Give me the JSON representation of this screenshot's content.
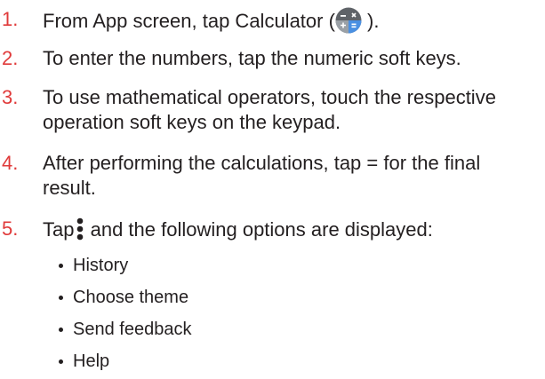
{
  "steps": [
    {
      "number": "1.",
      "before": "From App screen, tap Calculator (",
      "after": " )."
    },
    {
      "number": "2.",
      "text": "To enter the numbers, tap the numeric soft keys."
    },
    {
      "number": "3.",
      "line1": "To use mathematical operators, touch the respective",
      "line2": "operation soft keys on the keypad."
    },
    {
      "number": "4.",
      "line1": "After performing the calculations, tap = for the final",
      "line2": "result."
    },
    {
      "number": "5.",
      "before": "Tap",
      "after": " and the following options are displayed:"
    }
  ],
  "options": [
    "History",
    "Choose theme",
    "Send feedback",
    "Help"
  ],
  "icons": {
    "calculator": "calculator-app-icon",
    "menu": "more-options-icon"
  },
  "colors": {
    "step_number": "#e03a3a",
    "text": "#231f20"
  }
}
